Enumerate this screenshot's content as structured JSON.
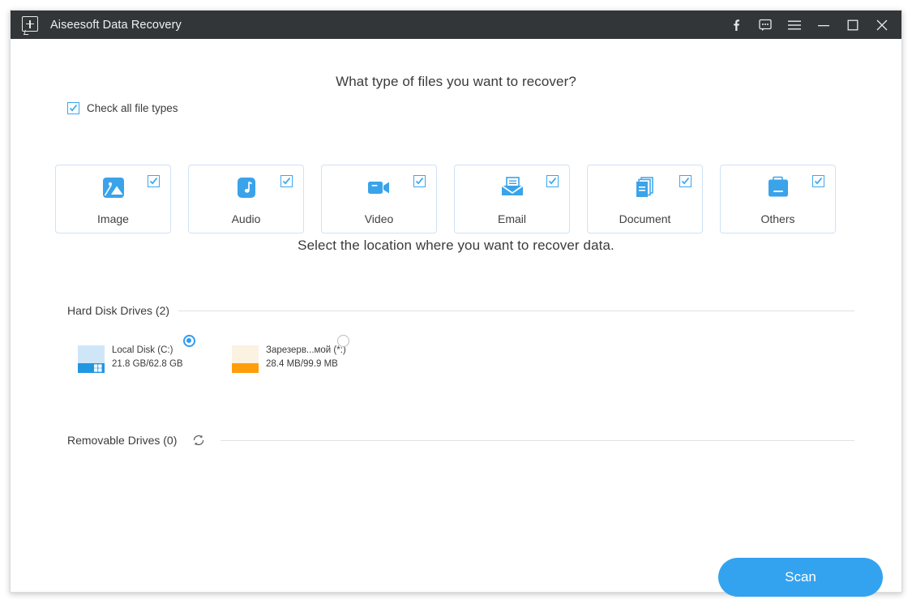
{
  "window": {
    "title": "Aiseesoft Data Recovery",
    "logo_icon": "app-plus-bubble-icon",
    "controls": [
      {
        "name": "facebook-icon",
        "label": "f"
      },
      {
        "name": "feedback-bubble-icon",
        "label": ""
      },
      {
        "name": "menu-hamburger-icon",
        "label": ""
      },
      {
        "name": "minimize-icon",
        "label": ""
      },
      {
        "name": "maximize-icon",
        "label": ""
      },
      {
        "name": "close-icon",
        "label": ""
      }
    ]
  },
  "main": {
    "files_heading": "What type of files you want to recover?",
    "check_all_label": "Check all file types",
    "check_all_checked": true,
    "location_heading": "Select the location where you want to recover data.",
    "file_types": [
      {
        "label": "Image",
        "icon": "image-icon",
        "checked": true
      },
      {
        "label": "Audio",
        "icon": "audio-note-icon",
        "checked": true
      },
      {
        "label": "Video",
        "icon": "video-camera-icon",
        "checked": true
      },
      {
        "label": "Email",
        "icon": "email-envelope-icon",
        "checked": true
      },
      {
        "label": "Document",
        "icon": "document-pages-icon",
        "checked": true
      },
      {
        "label": "Others",
        "icon": "others-folder-icon",
        "checked": true
      }
    ],
    "hard_disk_group": {
      "label": "Hard Disk Drives (2)",
      "drives": [
        {
          "name": "Local Disk (C:)",
          "size": "21.8 GB/62.8 GB",
          "selected": true,
          "icon": "windows-drive-icon",
          "icon_top_color": "#cfe6f8",
          "icon_bottom_color": "#2196e3"
        },
        {
          "name": "Зарезерв...мой (*:)",
          "size": "28.4 MB/99.9 MB",
          "selected": false,
          "icon": "drive-icon",
          "icon_top_color": "#fbf2e1",
          "icon_bottom_color": "#ff9e0c"
        }
      ]
    },
    "removable_group": {
      "label": "Removable Drives (0)",
      "refresh_icon": "refresh-icon"
    },
    "scan_button_label": "Scan"
  },
  "colors": {
    "accent_blue": "#33a3ef",
    "icon_blue": "#3aa3ea",
    "titlebar": "#333639",
    "card_border": "#cfe2f5"
  }
}
